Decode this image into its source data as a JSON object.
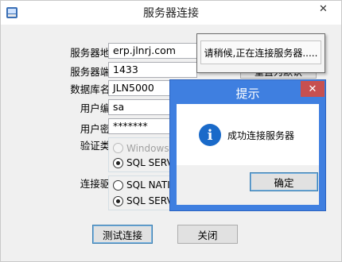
{
  "window": {
    "title": "服务器连接",
    "close_glyph": "✕"
  },
  "form": {
    "server_address": {
      "label": "服务器地址:",
      "value": "erp.jlnrj.com"
    },
    "server_port": {
      "label": "服务器端口:",
      "value": "1433"
    },
    "database_name": {
      "label": "数据库名称:",
      "value": "JLN5000"
    },
    "user_id": {
      "label": "用户编号:",
      "value": "sa"
    },
    "password": {
      "label": "用户密码:",
      "value": "*******"
    },
    "reset_default_label": "重置为默认",
    "auth_type": {
      "label": "验证类型:",
      "options": [
        {
          "label": "Windows身",
          "checked": false,
          "disabled": true
        },
        {
          "label": "SQL SERV",
          "checked": true,
          "disabled": false
        }
      ]
    },
    "driver": {
      "label": "连接驱动:",
      "options": [
        {
          "label": "SQL NATIV",
          "checked": false,
          "disabled": false
        },
        {
          "label": "SQL SERV",
          "checked": true,
          "disabled": false
        }
      ]
    }
  },
  "buttons": {
    "test_connection": "测试连接",
    "close": "关闭"
  },
  "tooltip": {
    "text": "请稍候,正在连接服务器....."
  },
  "message_box": {
    "title": "提示",
    "close_glyph": "✕",
    "icon": "info-icon",
    "icon_glyph": "i",
    "message": "成功连接服务器",
    "ok_label": "确定"
  },
  "colors": {
    "dialog_accent": "#3f7fe0",
    "close_red": "#c75050",
    "info_blue": "#1a6ac9"
  }
}
